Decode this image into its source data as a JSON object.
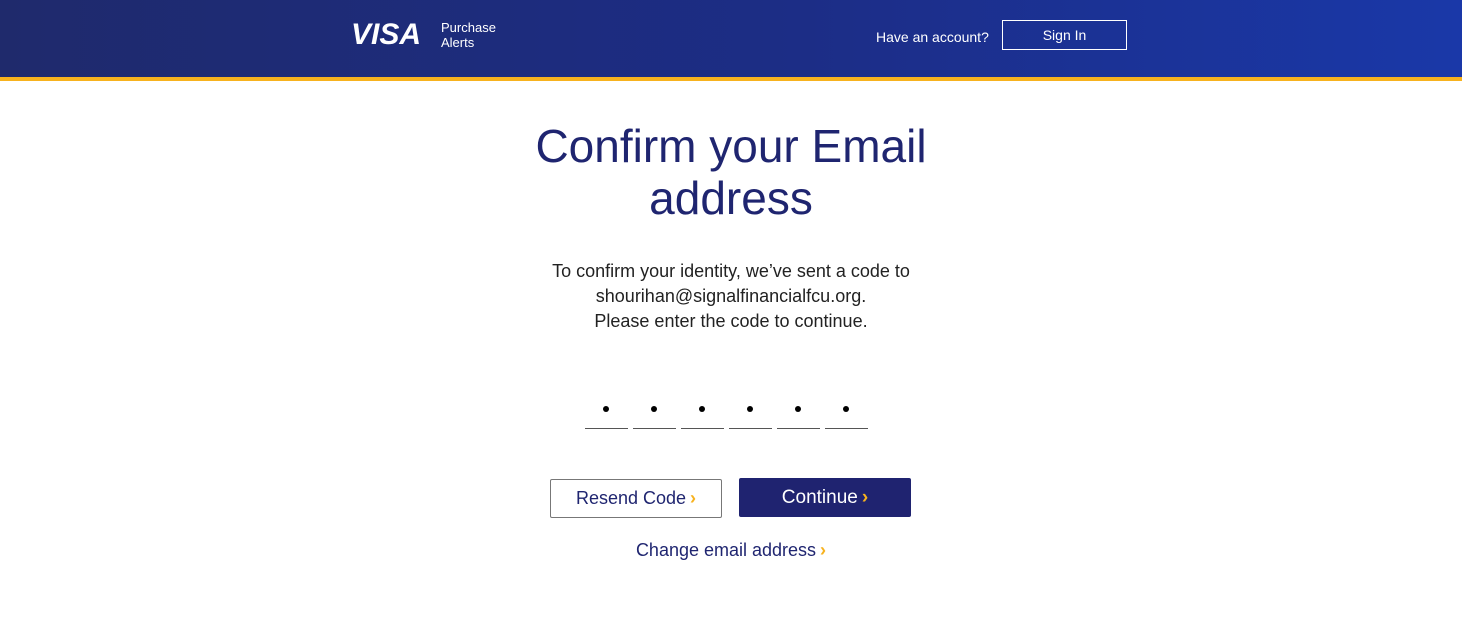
{
  "header": {
    "logo_brand": "VISA",
    "logo_line1": "Purchase",
    "logo_line2": "Alerts",
    "account_prompt": "Have an account?",
    "signin_label": "Sign In"
  },
  "main": {
    "title_line1": "Confirm your Email",
    "title_line2": "address",
    "message_line1": "To confirm your identity, we’ve sent a code to",
    "message_line2": "shourihan@signalfinancialfcu.org.",
    "message_line3": "Please enter the code to continue.",
    "code_digits_entered": 6,
    "resend_label": "Resend Code",
    "continue_label": "Continue",
    "change_email_label": "Change email address",
    "chevron_glyph": "›"
  },
  "colors": {
    "header_dark": "#1f2a6c",
    "header_light": "#1a38a8",
    "accent_gold": "#f7b21e",
    "primary_navy": "#1f2370"
  }
}
